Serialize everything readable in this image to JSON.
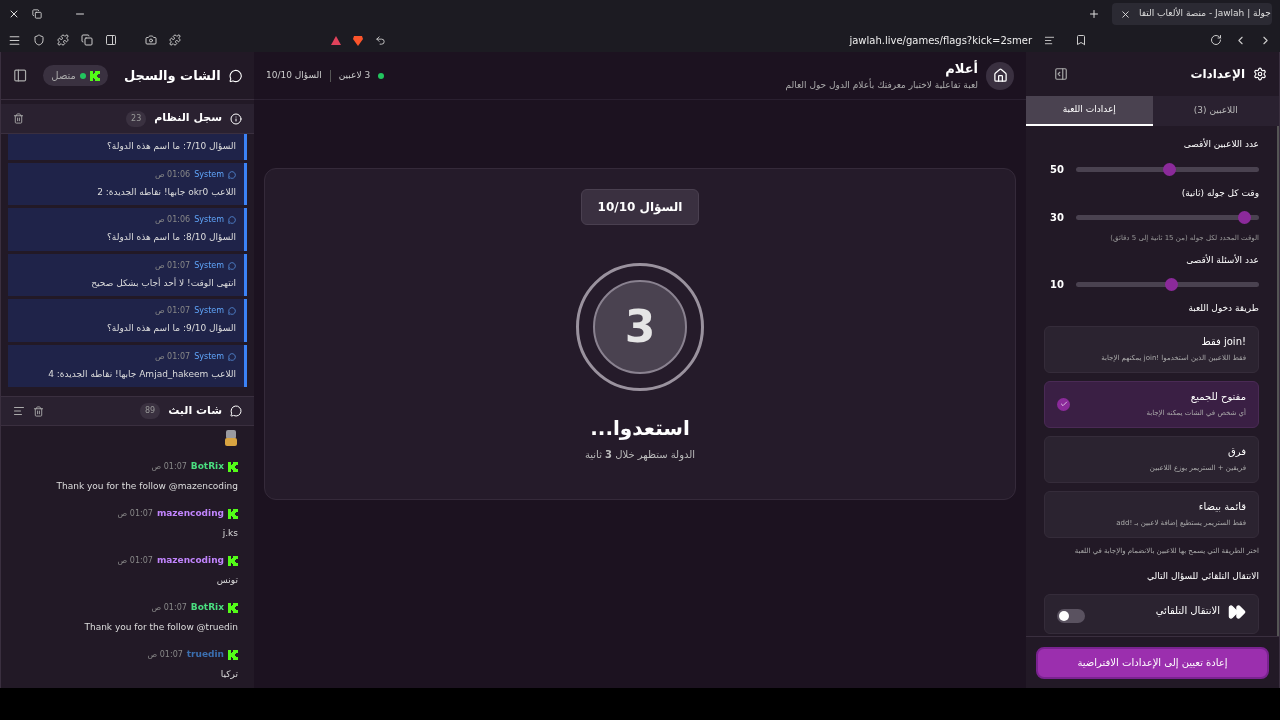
{
  "browser": {
    "tab_title": "جولة | Jawlah - منصة الألعاب التفا",
    "url": "jawlah.live/games/flags?kick=2smer"
  },
  "chat_panel": {
    "title": "الشات والسجل",
    "status": "متصل",
    "connected": true,
    "system_log": {
      "title": "سجل النظام",
      "count": "23",
      "messages": [
        {
          "text": "السؤال 7/10: ما اسم هذه الدولة؟"
        },
        {
          "sender": "System",
          "time": "01:06 ص",
          "text": "اللاعب okr0 جابها! نقاطه الجديدة: 2"
        },
        {
          "sender": "System",
          "time": "01:06 ص",
          "text": "السؤال 8/10: ما اسم هذه الدولة؟"
        },
        {
          "sender": "System",
          "time": "01:07 ص",
          "text": "انتهى الوقت! لا أحد أجاب بشكل صحيح"
        },
        {
          "sender": "System",
          "time": "01:07 ص",
          "text": "السؤال 9/10: ما اسم هذه الدولة؟"
        },
        {
          "sender": "System",
          "time": "01:07 ص",
          "text": "اللاعب Amjad_hakeem جابها! نقاطه الجديدة: 4"
        }
      ]
    },
    "stream_chat": {
      "title": "شات البث",
      "count": "89",
      "messages": [
        {
          "kind": "sticker"
        },
        {
          "kind": "text",
          "user": "BotRix",
          "color": "#4ade80",
          "time": "01:07 ص",
          "text": "Thank you for the follow @mazencoding"
        },
        {
          "kind": "text",
          "user": "mazencoding",
          "color": "#c084fc",
          "time": "01:07 ص",
          "text": "j.ks"
        },
        {
          "kind": "text",
          "user": "mazencoding",
          "color": "#c084fc",
          "time": "01:07 ص",
          "text": "تونس"
        },
        {
          "kind": "text",
          "user": "BotRix",
          "color": "#4ade80",
          "time": "01:07 ص",
          "text": "Thank you for the follow @truedin"
        },
        {
          "kind": "text",
          "user": "truedin",
          "color": "#3b6fb0",
          "time": "01:07 ص",
          "text": "تركيا"
        }
      ]
    }
  },
  "game": {
    "title": "أعلام",
    "subtitle": "لعبة تفاعلية لاختبار معرفتك بأعلام الدول حول العالم",
    "players": "3 لاعبين",
    "question": "السؤال 10/10",
    "card": {
      "badge": "السؤال 10/10",
      "countdown": "3",
      "heading": "استعدوا...",
      "note": "الدولة ستظهر خلال **3** ثانية"
    }
  },
  "settings": {
    "title": "الإعدادات",
    "tabs": [
      {
        "label": "اللاعبين (3)",
        "selected": false
      },
      {
        "label": "إعدادات اللعبة",
        "selected": true
      }
    ],
    "sliders": [
      {
        "label": "عدد اللاعبين الأقصى",
        "value": "50",
        "level": 0.51
      },
      {
        "label": "وقت كل جوله (ثانية)",
        "value": "30",
        "level": 0.92,
        "hint": "الوقت المحدد لكل جوله (من 15 ثانية إلى 5 دقائق)"
      },
      {
        "label": "عدد الأسئلة الأقصى",
        "value": "10",
        "level": 0.52
      }
    ],
    "entry_mode": {
      "label": "طريقة دخول اللعبة",
      "options": [
        {
          "title": "!join فقط",
          "description": "فقط اللاعبين الذين استخدموا !join يمكنهم الإجابة",
          "selected": false
        },
        {
          "title": "مفتوح للجميع",
          "description": "أي شخص في الشات يمكنه الإجابة",
          "selected": true
        },
        {
          "title": "فرق",
          "description": "فريقين + الستريمر يوزع اللاعبين",
          "selected": false
        },
        {
          "title": "قائمة بيضاء",
          "description": "فقط الستريمر يستطيع إضافة لاعبين بـ !add",
          "selected": false
        }
      ],
      "hint": "اختر الطريقة التي يسمح بها للاعبين بالانضمام والإجابة في اللعبة"
    },
    "auto_advance": {
      "label": "الانتقال التلقائي للسؤال التالي",
      "title": "الانتقال التلقائي",
      "on": false
    },
    "reset_button": "إعادة تعيين إلى الإعدادات الافتراضية"
  }
}
